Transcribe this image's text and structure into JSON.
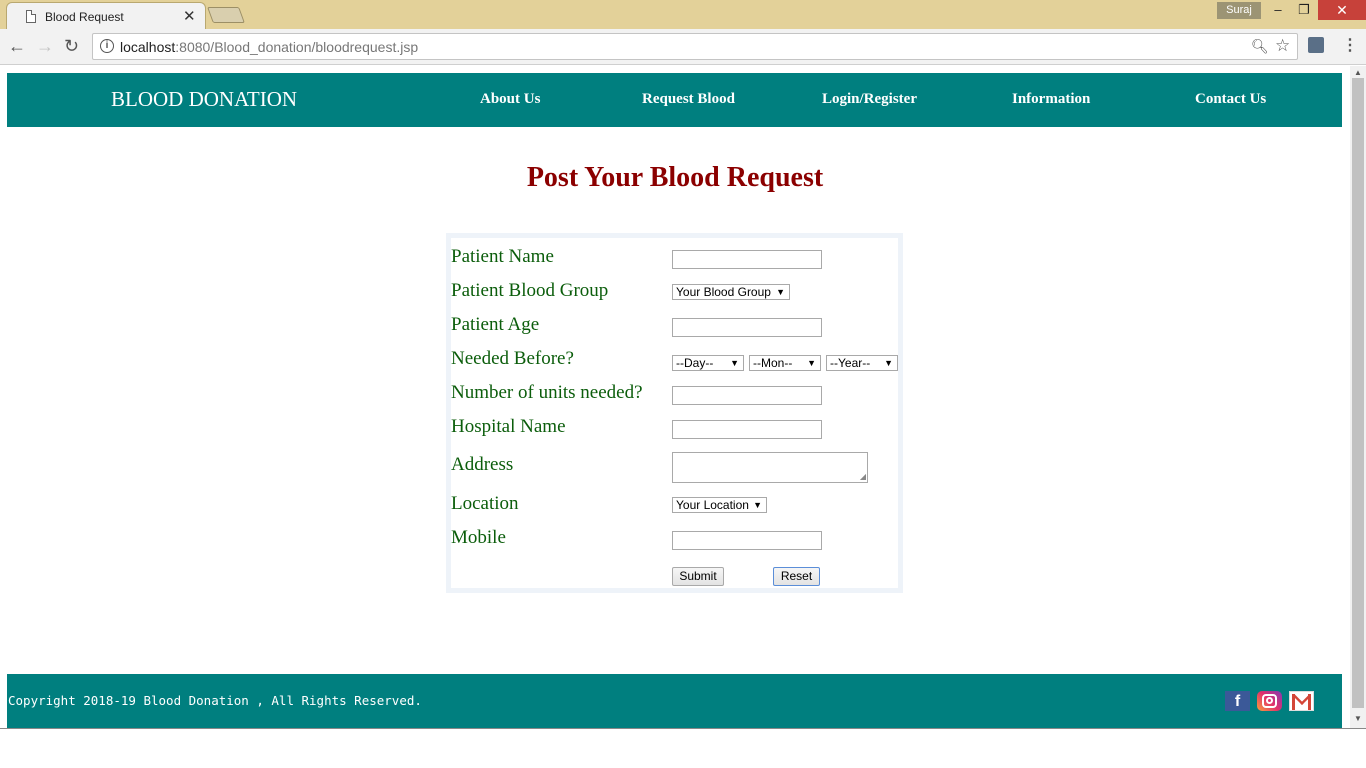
{
  "browser": {
    "tab_title": "Blood Request",
    "tab_close": "✕",
    "user": "Suraj",
    "url_host": "localhost",
    "url_rest": ":8080/Blood_donation/bloodrequest.jsp",
    "window_controls": {
      "minimize": "–",
      "maximize": "❐",
      "close": "✕"
    }
  },
  "header": {
    "brand": "BLOOD DONATION",
    "nav": [
      "About Us",
      "Request Blood",
      "Login/Register",
      "Information",
      "Contact Us"
    ]
  },
  "page": {
    "title": "Post Your Blood Request"
  },
  "form": {
    "labels": {
      "patient_name": "Patient Name",
      "blood_group": "Patient Blood Group",
      "age": "Patient Age",
      "needed_before": "Needed Before?",
      "units": "Number of units needed?",
      "hospital": "Hospital Name",
      "address": "Address",
      "location": "Location",
      "mobile": "Mobile"
    },
    "selects": {
      "blood_group": "Your Blood Group",
      "day": "--Day--",
      "month": "--Mon--",
      "year": "--Year--",
      "location": "Your Location"
    },
    "buttons": {
      "submit": "Submit",
      "reset": "Reset"
    }
  },
  "footer": {
    "copyright": "Copyright 2018-19 Blood Donation , All Rights Reserved.",
    "social": [
      "facebook-icon",
      "instagram-icon",
      "gmail-icon"
    ],
    "facebook_glyph": "f"
  },
  "colors": {
    "header_bg": "#007f7f",
    "title": "#8b0000",
    "labels": "#0b5d0b",
    "tabstrip": "#e3d199"
  }
}
